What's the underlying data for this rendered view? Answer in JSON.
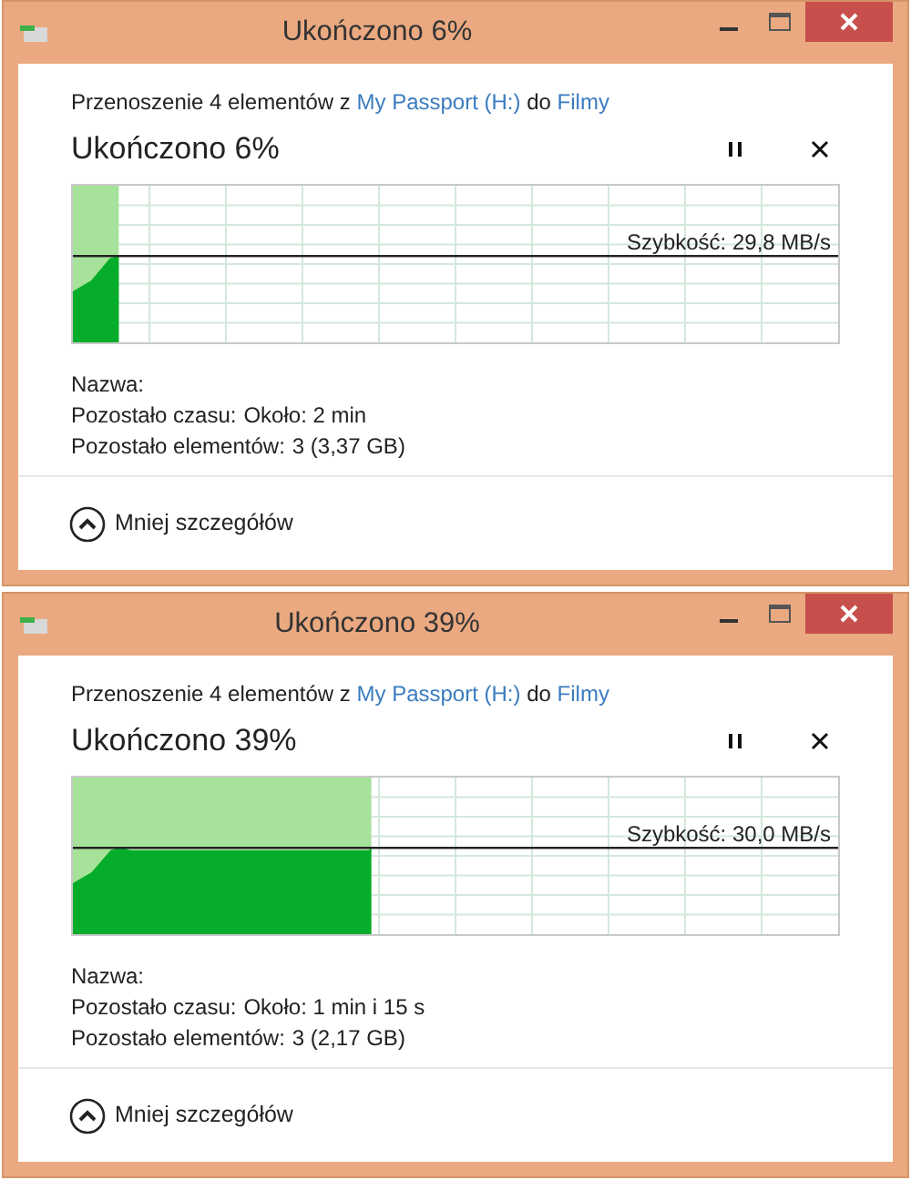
{
  "windows": [
    {
      "title": "Ukończono 6%",
      "description": [
        {
          "kind": "text",
          "text": "Przenoszenie 4 elementów z "
        },
        {
          "kind": "link",
          "text": "My Passport (H:)"
        },
        {
          "kind": "text",
          "text": " do "
        },
        {
          "kind": "link",
          "text": "Filmy"
        }
      ],
      "heading": "Ukończono 6%",
      "graph": {
        "level": 0.06,
        "speed": "Szybkość: 29,8 MB/s"
      },
      "details": [
        {
          "label": "Nazwa:"
        },
        {
          "label": "Pozostało czasu:",
          "value": "Około: 2 min"
        },
        {
          "label": "Pozostało elementów:",
          "value": "3 (3,37 GB)"
        }
      ],
      "toggle": "Mniej szczegółów"
    },
    {
      "title": "Ukończono 39%",
      "description": [
        {
          "kind": "text",
          "text": "Przenoszenie 4 elementów z "
        },
        {
          "kind": "link",
          "text": "My Passport (H:)"
        },
        {
          "kind": "text",
          "text": " do "
        },
        {
          "kind": "link",
          "text": "Filmy"
        }
      ],
      "heading": "Ukończono 39%",
      "graph": {
        "level": 0.39,
        "speed": "Szybkość: 30,0 MB/s"
      },
      "details": [
        {
          "label": "Nazwa:"
        },
        {
          "label": "Pozostało czasu:",
          "value": "Około: 1 min i 15 s"
        },
        {
          "label": "Pozostało elementów:",
          "value": "3 (2,17 GB)"
        }
      ],
      "toggle": "Mniej szczegółów"
    }
  ]
}
